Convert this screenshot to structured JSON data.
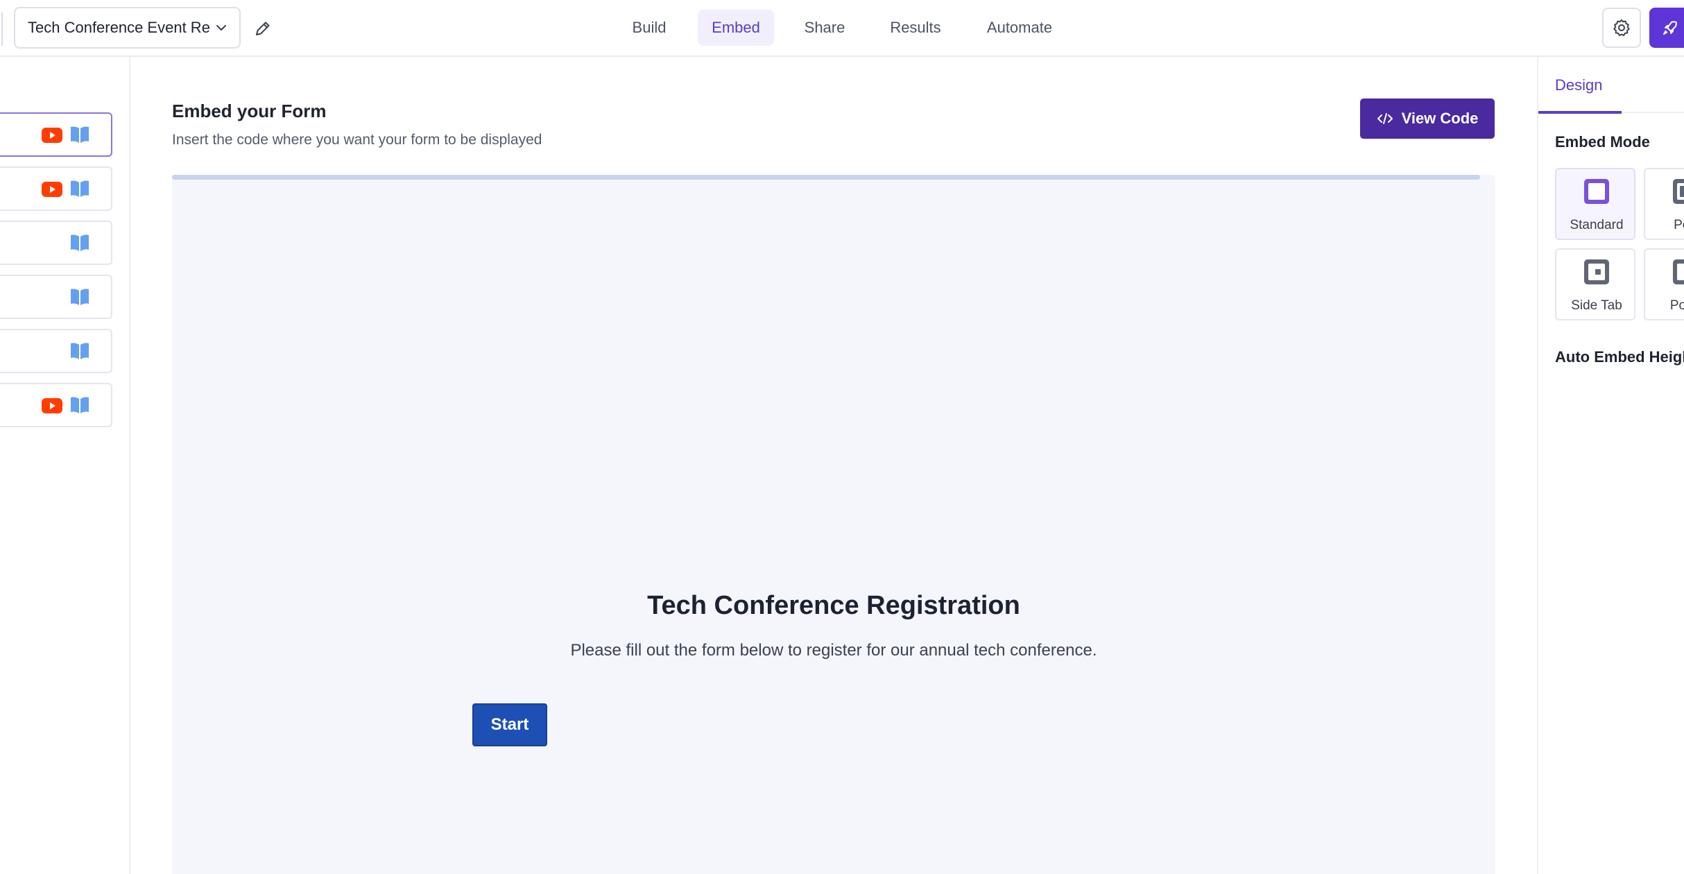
{
  "header": {
    "form_name": "Tech Conference Event Re",
    "nav_tabs": [
      {
        "label": "Build"
      },
      {
        "label": "Embed",
        "active": true
      },
      {
        "label": "Share"
      },
      {
        "label": "Results"
      },
      {
        "label": "Automate"
      }
    ]
  },
  "sidebar": {
    "items": [
      {
        "icons": [
          "youtube-icon",
          "book-icon"
        ],
        "selected": true
      },
      {
        "icons": [
          "youtube-icon",
          "book-icon"
        ]
      },
      {
        "icons": [
          "book-icon"
        ]
      },
      {
        "icons": [
          "book-icon"
        ]
      },
      {
        "icons": [
          "book-icon"
        ]
      },
      {
        "icons": [
          "youtube-icon",
          "book-icon"
        ]
      }
    ]
  },
  "main": {
    "title": "Embed your Form",
    "subtitle": "Insert the code where you want your form to be displayed",
    "view_code_label": "View Code",
    "preview": {
      "form_title": "Tech Conference Registration",
      "form_description": "Please fill out the form below to register for our annual tech conference.",
      "start_label": "Start"
    }
  },
  "right_panel": {
    "tab": "Design",
    "embed_mode_heading": "Embed Mode",
    "modes": [
      {
        "label": "Standard",
        "selected": true
      },
      {
        "label": "Pop"
      },
      {
        "label": "Side Tab"
      },
      {
        "label": "Popo"
      }
    ],
    "auto_embed_heading": "Auto Embed Heigh"
  },
  "colors": {
    "accent": "#5b3cc4",
    "primary_dark": "#4a2a9e",
    "start_button": "#1e4fb5",
    "youtube_red": "#ff3d00",
    "book_blue": "#64a0ee"
  }
}
